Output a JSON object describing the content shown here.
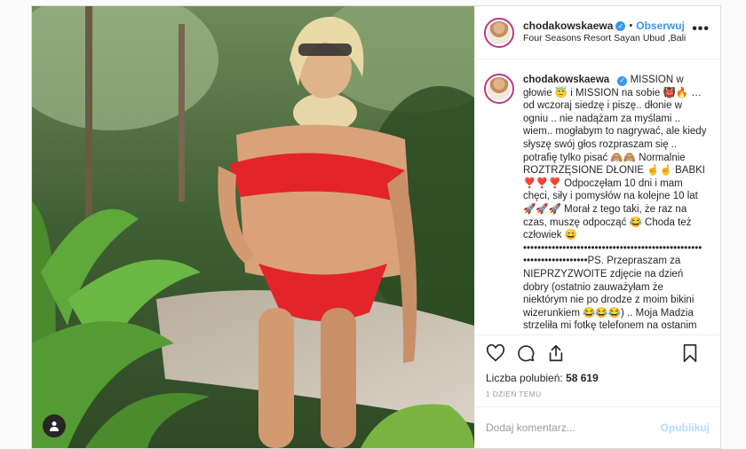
{
  "post": {
    "username": "chodakowskaewa",
    "verified_glyph": "✓",
    "separator": "•",
    "follow_label": "Obserwuj",
    "location": "Four Seasons Resort Sayan Ubud ,Bali",
    "more_glyph": "•••",
    "caption": "MISSION w głowie 😇 i MISSION na sobie 👹🔥 … od wczoraj siedzę i piszę.. dłonie w ogniu .. nie nadążam za myślami .. wiem.. mogłabym to nagrywać, ale kiedy słyszę swój głos rozpraszam się .. potrafię tylko pisać 🙈🙈 Normalnie ROZTRZĘSIONE DŁONIE ☝️☝️ BABKI ❣️❣️❣️ Odpoczęłam 10 dni i mam chęci, siły i pomysłów na kolejne 10 lat 🚀🚀🚀 Morał z tego taki, że raz na czas, muszę odpocząć 😂 Choda też człowiek 😄 •••••••••••••••••••••••••••••••••••••••••••••••••• ••••••••••••••••••PS. Przepraszam za NIEPRZYZWOITE zdjęcie na dzień dobry (ostatnio zauważyłam że niektórym nie po drodze z moim bikini wizerunkiem 😂😂😂) .. Moja Madzia strzeliła mi fotkę telefonem na ostanim",
    "likes_label": "Liczba polubień:",
    "likes_count": "58 619",
    "time_ago": "1 DZIEŃ TEMU",
    "comment_placeholder": "Dodaj komentarz...",
    "publish_label": "Opublikuj"
  },
  "icons": {
    "like": "heart-icon",
    "comment": "comment-icon",
    "share": "share-icon",
    "save": "bookmark-icon",
    "tag": "user-tag-icon"
  },
  "colors": {
    "link": "#3897f0",
    "verified": "#3897f0",
    "publish_disabled": "#b3dbff",
    "story_ring": "#c13584"
  }
}
